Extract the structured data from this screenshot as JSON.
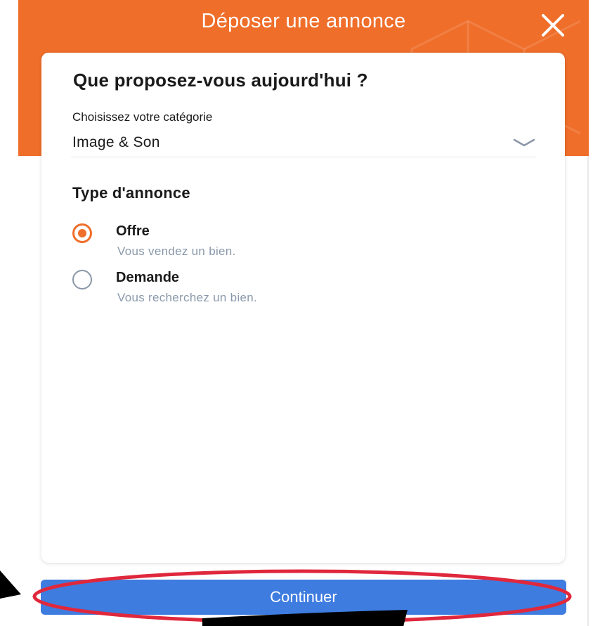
{
  "header": {
    "title": "Déposer une annonce",
    "close_icon": "close-icon",
    "background_color": "#ef6e2a"
  },
  "card": {
    "title": "Que proposez-vous aujourd'hui ?",
    "category": {
      "label": "Choisissez votre catégorie",
      "value": "Image & Son",
      "icon": "chevron-down-icon"
    },
    "ad_type": {
      "title": "Type d'annonce",
      "options": [
        {
          "label": "Offre",
          "description": "Vous vendez un bien.",
          "selected": true
        },
        {
          "label": "Demande",
          "description": "Vous recherchez un bien.",
          "selected": false
        }
      ]
    }
  },
  "footer": {
    "continue_label": "Continuer",
    "button_color": "#3e7ce0"
  },
  "annotation": {
    "highlight_color": "#e0283c",
    "arrow_icon": "pointer-arrow-icon"
  }
}
